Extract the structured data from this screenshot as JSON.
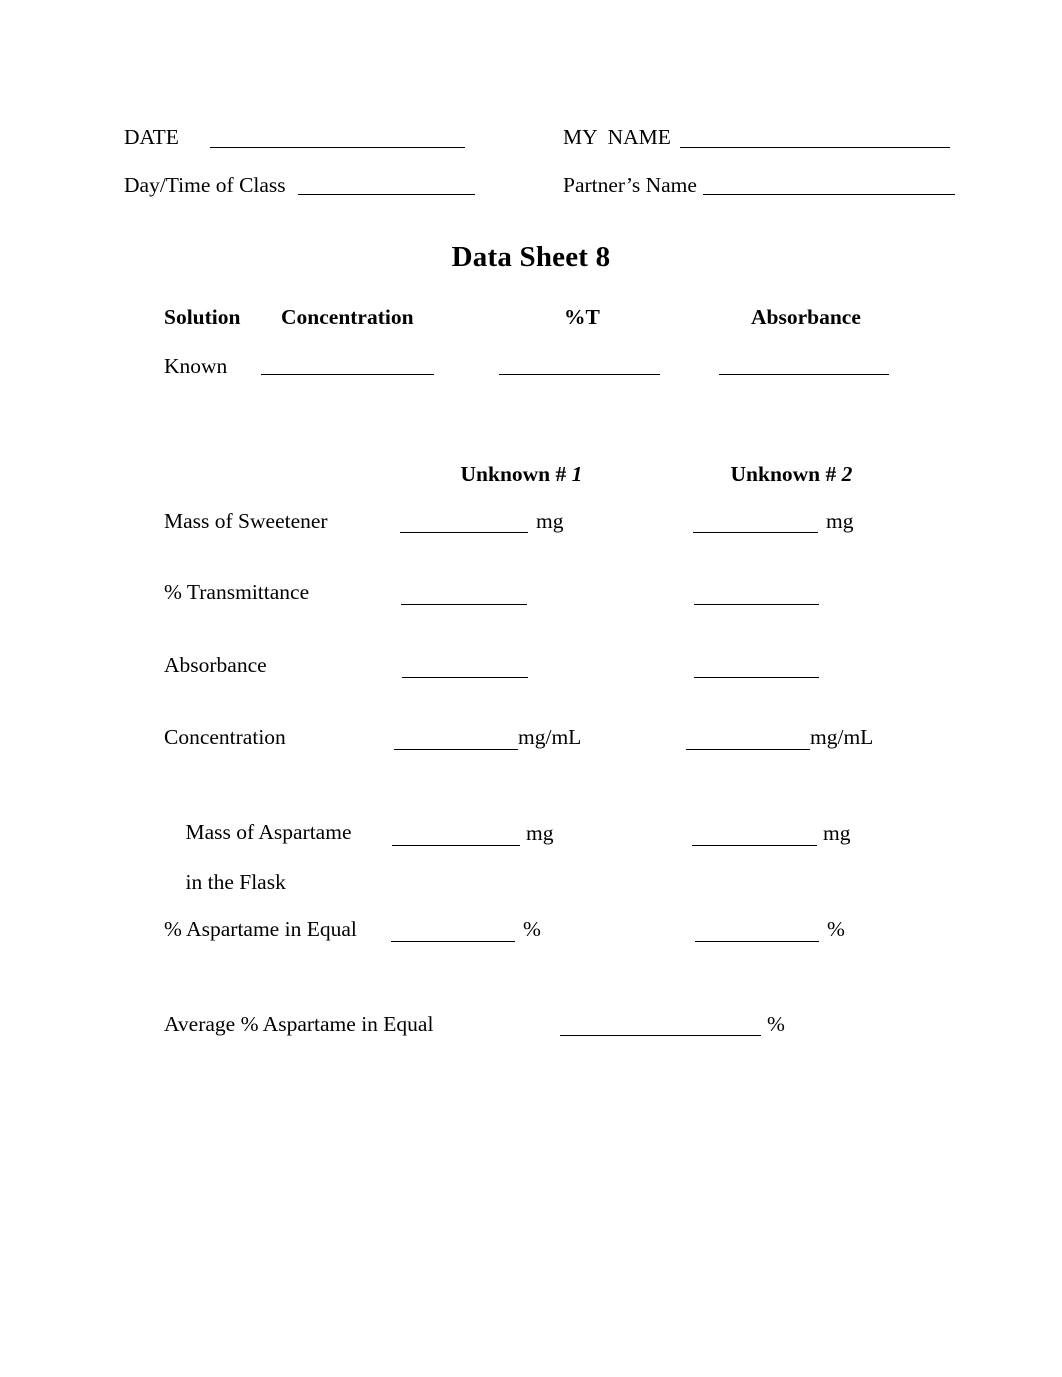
{
  "header": {
    "date_label": "DATE",
    "name_label": "MY  NAME",
    "class_label": "Day/Time of Class",
    "partner_label": "Partner’s Name"
  },
  "title": "Data Sheet 8",
  "known_table": {
    "columns": [
      "Solution",
      "Concentration",
      "%T",
      "Absorbance"
    ],
    "rows": [
      {
        "solution": "Known",
        "concentration": "",
        "percent_t": "",
        "absorbance": ""
      }
    ]
  },
  "unknown_table": {
    "column_headers": [
      "Unknown # 1",
      "Unknown # 2"
    ],
    "header_parts": [
      {
        "text": "Unknown # ",
        "number": "1"
      },
      {
        "text": "Unknown # ",
        "number": "2"
      }
    ],
    "rows": [
      {
        "label": "Mass of Sweetener",
        "unit": "mg",
        "unknown_1": "",
        "unknown_2": ""
      },
      {
        "label": "% Transmittance",
        "unit": "",
        "unknown_1": "",
        "unknown_2": ""
      },
      {
        "label": "Absorbance",
        "unit": "",
        "unknown_1": "",
        "unknown_2": ""
      },
      {
        "label": "Concentration",
        "unit": "mg/mL",
        "unknown_1": "",
        "unknown_2": ""
      },
      {
        "label_line_1": "Mass of Aspartame",
        "label_line_2": "in the Flask",
        "unit": "mg",
        "unknown_1": "",
        "unknown_2": ""
      },
      {
        "label": "% Aspartame in Equal",
        "unit": "%",
        "unknown_1": "",
        "unknown_2": ""
      }
    ]
  },
  "summary": {
    "label": "Average % Aspartame in Equal",
    "unit": "%",
    "value": ""
  }
}
